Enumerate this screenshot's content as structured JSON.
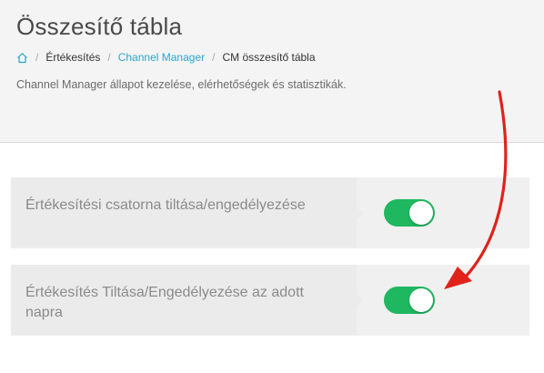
{
  "header": {
    "title": "Összesítő tábla",
    "subtitle": "Channel Manager állapot kezelése, elérhetőségek és statisztikák."
  },
  "breadcrumb": {
    "home_icon": "home-icon",
    "items": [
      "Értékesítés",
      "Channel Manager",
      "CM összesítő tábla"
    ],
    "separator": "/"
  },
  "settings": [
    {
      "label": "Értékesítési csatorna tiltása/engedélyezése",
      "enabled": true
    },
    {
      "label": "Értékesítés Tiltása/Engedélyezése az adott napra",
      "enabled": true
    }
  ],
  "colors": {
    "toggle_on": "#1fb760",
    "link": "#2aa6c8",
    "annotation_arrow": "#e0221b"
  }
}
